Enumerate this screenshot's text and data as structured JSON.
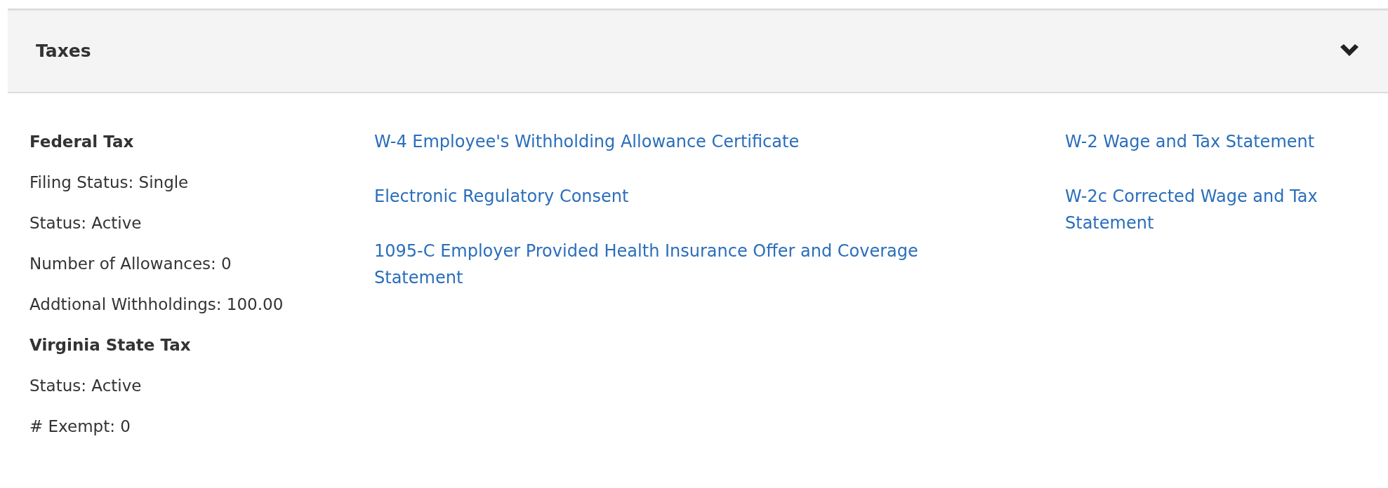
{
  "panel": {
    "title": "Taxes",
    "expanded": true,
    "details": [
      {
        "kind": "heading",
        "text": "Federal Tax"
      },
      {
        "kind": "line",
        "text": "Filing Status: Single"
      },
      {
        "kind": "line",
        "text": "Status: Active"
      },
      {
        "kind": "line",
        "text": "Number of Allowances: 0"
      },
      {
        "kind": "line",
        "text": "Addtional Withholdings: 100.00"
      },
      {
        "kind": "heading",
        "text": "Virginia State Tax"
      },
      {
        "kind": "line",
        "text": "Status: Active"
      },
      {
        "kind": "line",
        "text": "# Exempt: 0"
      }
    ],
    "links_column_1": [
      "W-4 Employee's Withholding Allowance Certificate",
      "Electronic Regulatory Consent",
      "1095-C Employer Provided Health Insurance Offer and Coverage Statement"
    ],
    "links_column_2": [
      "W-2 Wage and Tax Statement",
      "W-2c Corrected Wage and Tax Statement"
    ]
  }
}
